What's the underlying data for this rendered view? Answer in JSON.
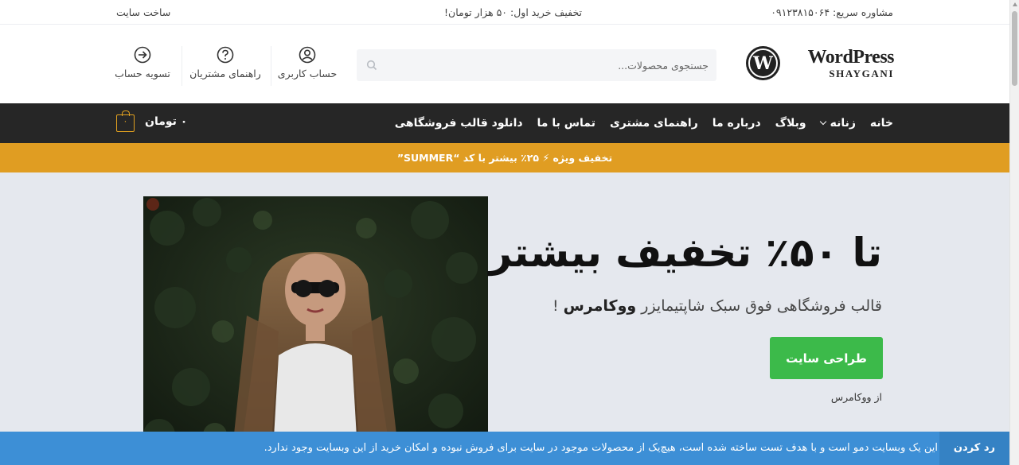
{
  "topbar": {
    "consult": "مشاوره سریع: ۰۹۱۲۳۸۱۵۰۶۴",
    "discount": "تخفیف خرید اول: ۵۰ هزار تومان!",
    "build_site": "ساخت سایت"
  },
  "logo": {
    "wordmark": "WordPress",
    "sub": "SHAYGANI",
    "mark": "W"
  },
  "search": {
    "placeholder": "جستجوی محصولات..."
  },
  "header_actions": [
    {
      "label": "حساب کاربری",
      "icon": "user-circle-icon"
    },
    {
      "label": "راهنمای مشتریان",
      "icon": "question-circle-icon"
    },
    {
      "label": "تسویه حساب",
      "icon": "arrow-circle-icon"
    }
  ],
  "nav": {
    "items": [
      {
        "label": "خانه"
      },
      {
        "label": "زنانه",
        "dropdown": true
      },
      {
        "label": "وبلاگ"
      },
      {
        "label": "درباره ما"
      },
      {
        "label": "راهنمای مشتری"
      },
      {
        "label": "تماس با ما"
      },
      {
        "label": "دانلود قالب فروشگاهی"
      }
    ],
    "cart_count": "۰",
    "cart_total": "۰ تومان"
  },
  "promo": {
    "text": "تخفیف ویژه ⚡ ۲۵٪ بیشتر با کد “SUMMER”"
  },
  "hero": {
    "title": "تا ۵۰٪ تخفیف بیشتر",
    "subtitle_prefix": "قالب فروشگاهی فوق سبک شاپتیمایزر ",
    "subtitle_bold": "ووکامرس",
    "subtitle_suffix": " !",
    "button": "طراحی سایت",
    "from": "از ووکامرس"
  },
  "notice": {
    "message": "این یک وبسایت دمو است و با هدف تست ساخته شده است، هیچ‌یک از محصولات موجود در سایت برای فروش نبوده و امکان خرید از این وبسایت وجود ندارد.",
    "dismiss": "رد کردن"
  },
  "colors": {
    "nav_bg": "#262626",
    "promo_bg": "#e09d22",
    "button_green": "#3cba4a",
    "notice_blue": "#3d8fd6"
  }
}
